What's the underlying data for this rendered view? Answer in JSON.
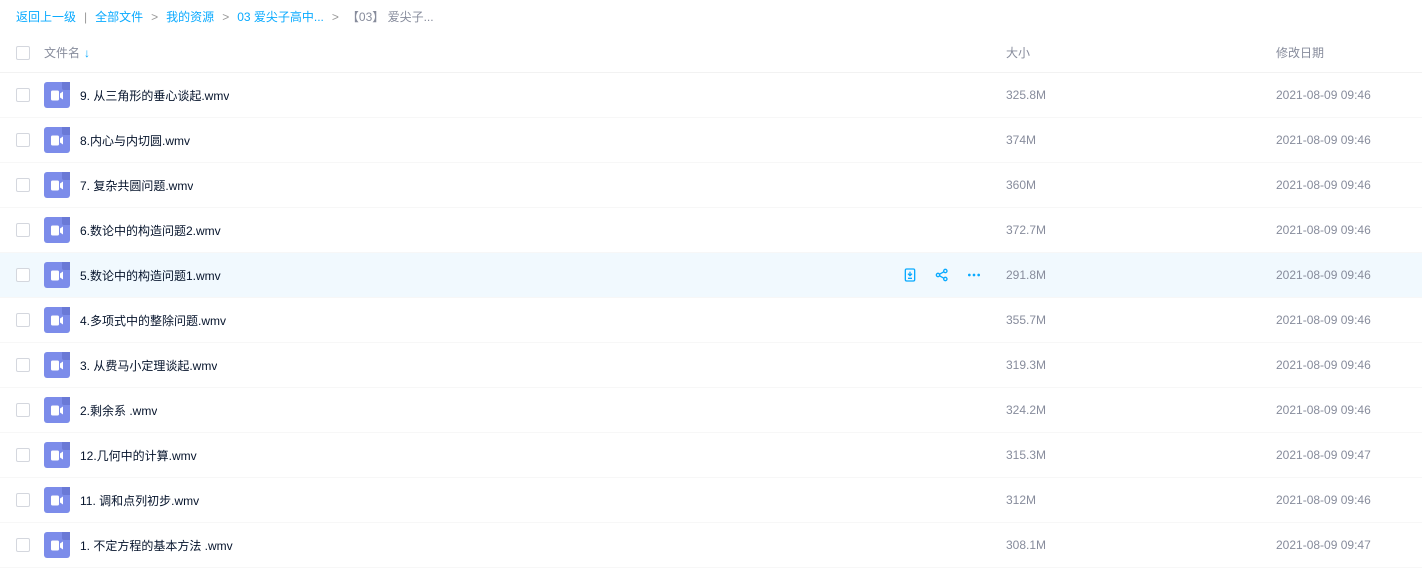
{
  "breadcrumb": {
    "back": "返回上一级",
    "items": [
      "全部文件",
      "我的资源",
      "03 爱尖子高中...",
      "【03】 爱尖子..."
    ]
  },
  "columns": {
    "name": "文件名",
    "size": "大小",
    "date": "修改日期"
  },
  "hover_index": 4,
  "files": [
    {
      "name": "9. 从三角形的垂心谈起.wmv",
      "size": "325.8M",
      "date": "2021-08-09 09:46"
    },
    {
      "name": "8.内心与内切圆.wmv",
      "size": "374M",
      "date": "2021-08-09 09:46"
    },
    {
      "name": "7. 复杂共圆问题.wmv",
      "size": "360M",
      "date": "2021-08-09 09:46"
    },
    {
      "name": "6.数论中的构造问题2.wmv",
      "size": "372.7M",
      "date": "2021-08-09 09:46"
    },
    {
      "name": "5.数论中的构造问题1.wmv",
      "size": "291.8M",
      "date": "2021-08-09 09:46"
    },
    {
      "name": "4.多项式中的整除问题.wmv",
      "size": "355.7M",
      "date": "2021-08-09 09:46"
    },
    {
      "name": "3. 从费马小定理谈起.wmv",
      "size": "319.3M",
      "date": "2021-08-09 09:46"
    },
    {
      "name": "2.剩余系 .wmv",
      "size": "324.2M",
      "date": "2021-08-09 09:46"
    },
    {
      "name": "12.几何中的计算.wmv",
      "size": "315.3M",
      "date": "2021-08-09 09:47"
    },
    {
      "name": "11. 调和点列初步.wmv",
      "size": "312M",
      "date": "2021-08-09 09:46"
    },
    {
      "name": "1. 不定方程的基本方法 .wmv",
      "size": "308.1M",
      "date": "2021-08-09 09:47"
    }
  ]
}
